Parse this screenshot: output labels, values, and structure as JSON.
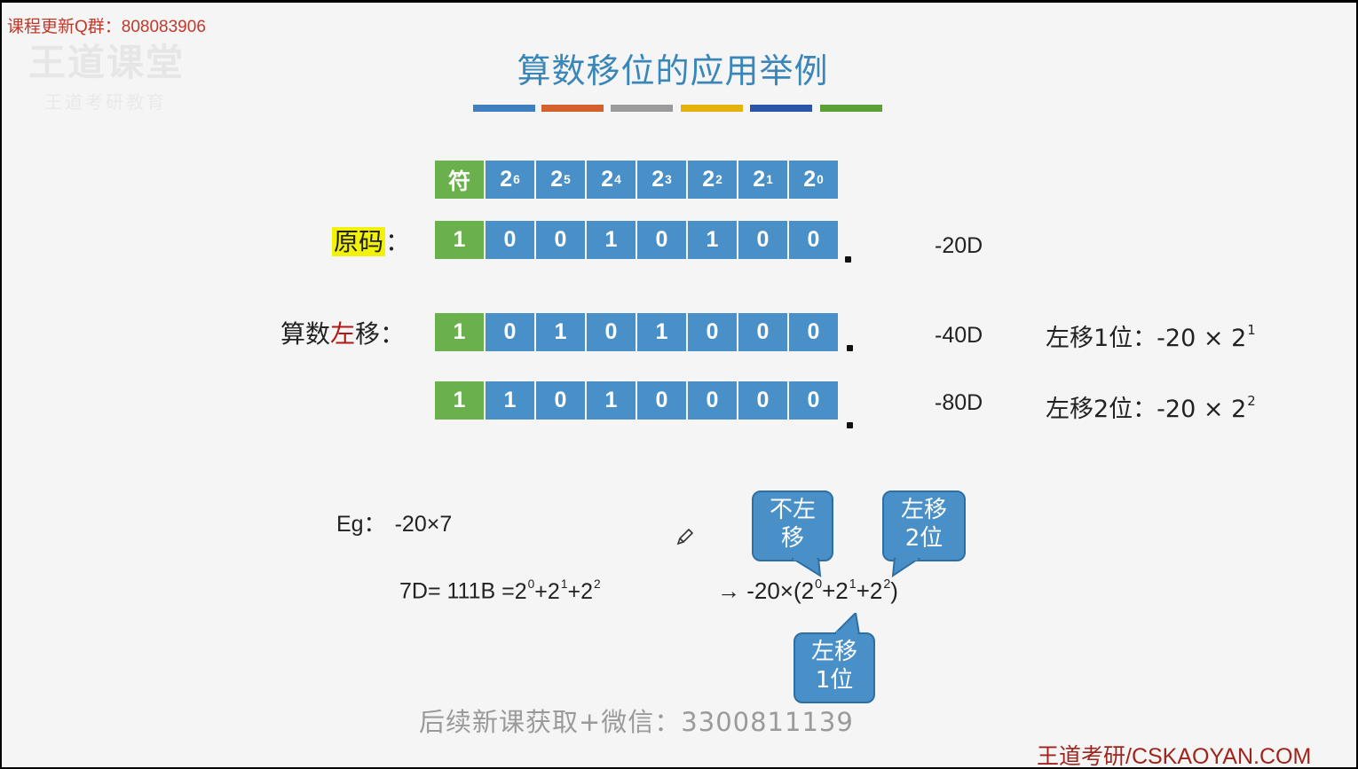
{
  "watermark_top": "课程更新Q群：808083906",
  "title": "算数移位的应用举例",
  "color_bars": [
    "#3f7fbf",
    "#d4602c",
    "#9b9b9b",
    "#e6b10d",
    "#2b55a6",
    "#5ba135"
  ],
  "header_cells": [
    {
      "base": "符",
      "exp": ""
    },
    {
      "base": "2",
      "exp": "6"
    },
    {
      "base": "2",
      "exp": "5"
    },
    {
      "base": "2",
      "exp": "4"
    },
    {
      "base": "2",
      "exp": "3"
    },
    {
      "base": "2",
      "exp": "2"
    },
    {
      "base": "2",
      "exp": "1"
    },
    {
      "base": "2",
      "exp": "0"
    }
  ],
  "original": {
    "label_hl": "原码",
    "label_suffix": "：",
    "bits": [
      "1",
      "0",
      "0",
      "1",
      "0",
      "1",
      "0",
      "0"
    ],
    "decimal": "-20D"
  },
  "shift1": {
    "label_a": "算数",
    "label_b": "左",
    "label_c": "移：",
    "bits": [
      "1",
      "0",
      "1",
      "0",
      "1",
      "0",
      "0",
      "0"
    ],
    "decimal": "-40D",
    "note_text": "左移1位：-20 × 2",
    "note_exp": "1"
  },
  "shift2": {
    "bits": [
      "1",
      "1",
      "0",
      "1",
      "0",
      "0",
      "0",
      "0"
    ],
    "decimal": "-80D",
    "note_text": "左移2位：-20 × 2",
    "note_exp": "2"
  },
  "example": {
    "eg_label": "Eg：",
    "eg_expr": "-20×7",
    "decomp_lhs": "7D= 111B =",
    "arrow_expr_lhs": "→ -20×(",
    "term_base": "2",
    "terms": [
      "0",
      "1",
      "2"
    ],
    "plus": "+",
    "close_paren": ")"
  },
  "callouts": {
    "no_shift": [
      "不左",
      "移"
    ],
    "shift2": [
      "左移",
      "2位"
    ],
    "shift1": [
      "左移",
      "1位"
    ]
  },
  "pencil_icon": "pencil-icon",
  "wechat_watermark": "后续新课获取+微信：3300811139",
  "brand": "王道考研/CSKAOYAN.COM"
}
